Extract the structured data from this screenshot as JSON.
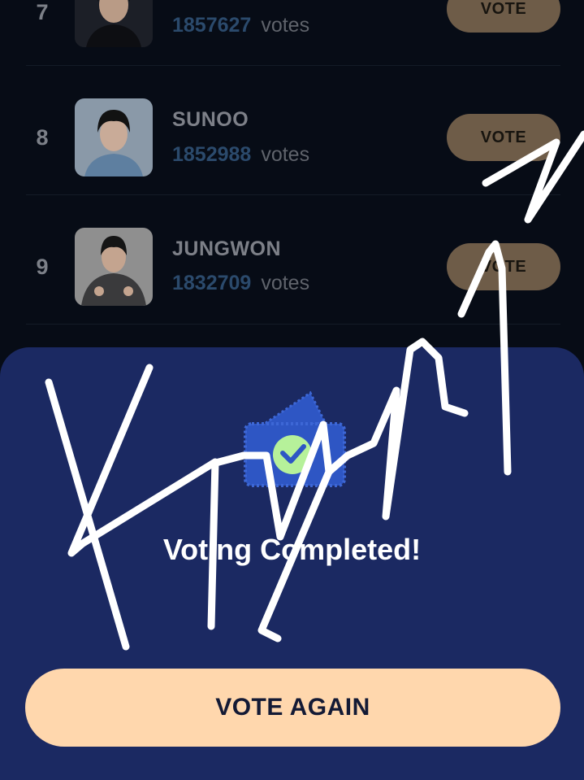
{
  "rankings": [
    {
      "rank": "7",
      "name": "",
      "votes": "1857627",
      "unit": "votes",
      "button": "VOTE"
    },
    {
      "rank": "8",
      "name": "SUNOO",
      "votes": "1852988",
      "unit": "votes",
      "button": "VOTE"
    },
    {
      "rank": "9",
      "name": "JUNGWON",
      "votes": "1832709",
      "unit": "votes",
      "button": "VOTE"
    }
  ],
  "modal": {
    "title": "Voting Completed!",
    "vote_again_label": "VOTE AGAIN",
    "icon": "ticket-check-icon"
  },
  "colors": {
    "background": "#070c16",
    "sheet": "#1b2962",
    "vote_button": "#6e5c48",
    "vote_again_button": "#ffd7ad",
    "vote_count": "#2b4a6c"
  }
}
